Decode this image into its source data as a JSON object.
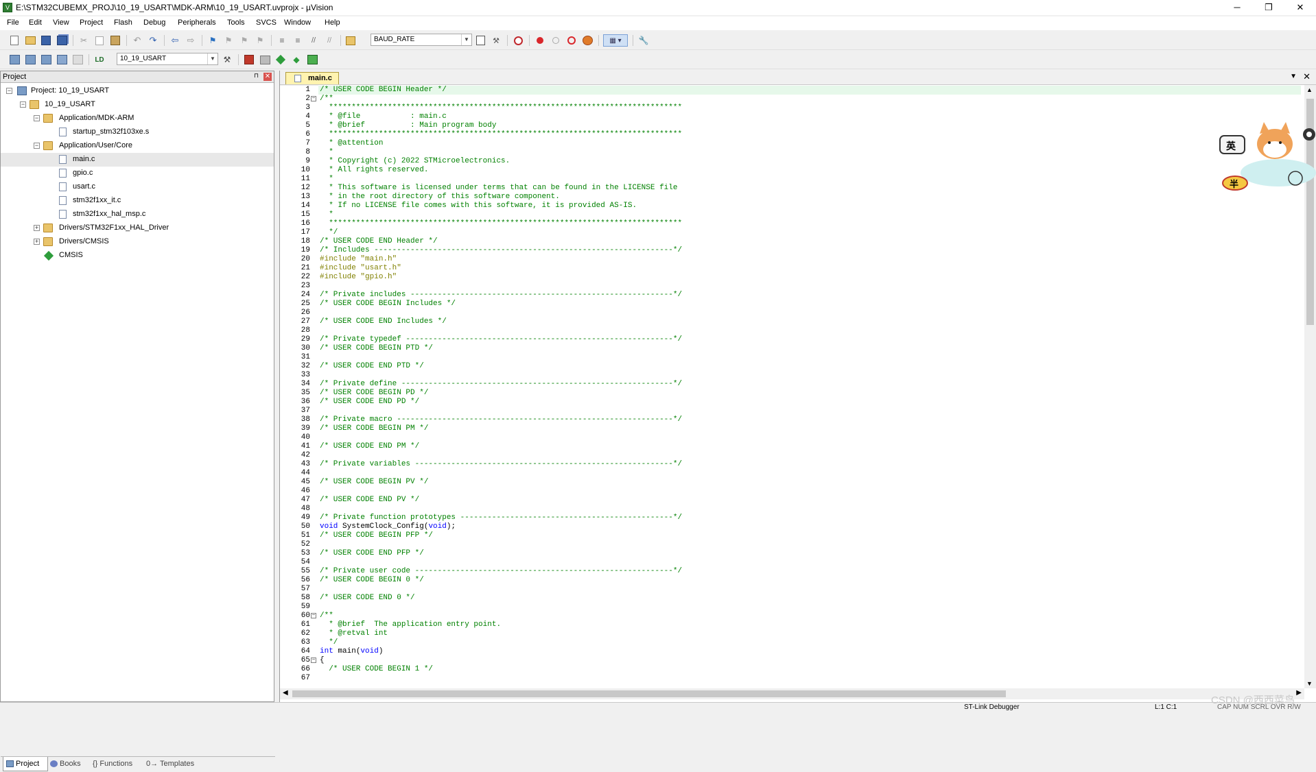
{
  "window": {
    "title": "E:\\STM32CUBEMX_PROJ\\10_19_USART\\MDK-ARM\\10_19_USART.uvprojx - µVision",
    "minimize": "─",
    "restore": "❐",
    "close": "✕"
  },
  "menu": [
    "File",
    "Edit",
    "View",
    "Project",
    "Flash",
    "Debug",
    "Peripherals",
    "Tools",
    "SVCS",
    "Window",
    "Help"
  ],
  "toolbar": {
    "find_combo_value": "BAUD_RATE",
    "target_combo_value": "10_19_USART"
  },
  "project_panel": {
    "title": "Project",
    "pin": "⊓",
    "close": "✕",
    "tree": [
      {
        "label": "Project: 10_19_USART",
        "toggle": "−"
      },
      {
        "label": "10_19_USART",
        "toggle": "−"
      },
      {
        "label": "Application/MDK-ARM",
        "toggle": "−"
      },
      {
        "label": "startup_stm32f103xe.s",
        "toggle": ""
      },
      {
        "label": "Application/User/Core",
        "toggle": "−"
      },
      {
        "label": "main.c",
        "toggle": ""
      },
      {
        "label": "gpio.c",
        "toggle": ""
      },
      {
        "label": "usart.c",
        "toggle": ""
      },
      {
        "label": "stm32f1xx_it.c",
        "toggle": ""
      },
      {
        "label": "stm32f1xx_hal_msp.c",
        "toggle": ""
      },
      {
        "label": "Drivers/STM32F1xx_HAL_Driver",
        "toggle": "+"
      },
      {
        "label": "Drivers/CMSIS",
        "toggle": "+"
      },
      {
        "label": "CMSIS",
        "toggle": ""
      }
    ],
    "tabs": [
      "Project",
      "Books",
      "{} Functions",
      "0→ Templates"
    ]
  },
  "editor": {
    "tab": "main.c",
    "tab_dropdown": "▼",
    "tab_close": "✕",
    "lines": [
      {
        "n": "1",
        "t": "/* USER CODE BEGIN Header */",
        "c": "comment"
      },
      {
        "n": "2",
        "t": "/**",
        "c": "comment",
        "f": "−"
      },
      {
        "n": "3",
        "t": "  ******************************************************************************",
        "c": "comment"
      },
      {
        "n": "4",
        "t": "  * @file           : main.c",
        "c": "comment"
      },
      {
        "n": "5",
        "t": "  * @brief          : Main program body",
        "c": "comment"
      },
      {
        "n": "6",
        "t": "  ******************************************************************************",
        "c": "comment"
      },
      {
        "n": "7",
        "t": "  * @attention",
        "c": "comment"
      },
      {
        "n": "8",
        "t": "  *",
        "c": "comment"
      },
      {
        "n": "9",
        "t": "  * Copyright (c) 2022 STMicroelectronics.",
        "c": "comment"
      },
      {
        "n": "10",
        "t": "  * All rights reserved.",
        "c": "comment"
      },
      {
        "n": "11",
        "t": "  *",
        "c": "comment"
      },
      {
        "n": "12",
        "t": "  * This software is licensed under terms that can be found in the LICENSE file",
        "c": "comment"
      },
      {
        "n": "13",
        "t": "  * in the root directory of this software component.",
        "c": "comment"
      },
      {
        "n": "14",
        "t": "  * If no LICENSE file comes with this software, it is provided AS-IS.",
        "c": "comment"
      },
      {
        "n": "15",
        "t": "  *",
        "c": "comment"
      },
      {
        "n": "16",
        "t": "  ******************************************************************************",
        "c": "comment"
      },
      {
        "n": "17",
        "t": "  */",
        "c": "comment"
      },
      {
        "n": "18",
        "t": "/* USER CODE END Header */",
        "c": "comment"
      },
      {
        "n": "19",
        "t": "/* Includes ------------------------------------------------------------------*/",
        "c": "comment"
      },
      {
        "n": "20",
        "t": "#include \"main.h\"",
        "c": "pre"
      },
      {
        "n": "21",
        "t": "#include \"usart.h\"",
        "c": "pre"
      },
      {
        "n": "22",
        "t": "#include \"gpio.h\"",
        "c": "pre"
      },
      {
        "n": "23",
        "t": "",
        "c": "code"
      },
      {
        "n": "24",
        "t": "/* Private includes ----------------------------------------------------------*/",
        "c": "comment"
      },
      {
        "n": "25",
        "t": "/* USER CODE BEGIN Includes */",
        "c": "comment"
      },
      {
        "n": "26",
        "t": "",
        "c": "code"
      },
      {
        "n": "27",
        "t": "/* USER CODE END Includes */",
        "c": "comment"
      },
      {
        "n": "28",
        "t": "",
        "c": "code"
      },
      {
        "n": "29",
        "t": "/* Private typedef -----------------------------------------------------------*/",
        "c": "comment"
      },
      {
        "n": "30",
        "t": "/* USER CODE BEGIN PTD */",
        "c": "comment"
      },
      {
        "n": "31",
        "t": "",
        "c": "code"
      },
      {
        "n": "32",
        "t": "/* USER CODE END PTD */",
        "c": "comment"
      },
      {
        "n": "33",
        "t": "",
        "c": "code"
      },
      {
        "n": "34",
        "t": "/* Private define ------------------------------------------------------------*/",
        "c": "comment"
      },
      {
        "n": "35",
        "t": "/* USER CODE BEGIN PD */",
        "c": "comment"
      },
      {
        "n": "36",
        "t": "/* USER CODE END PD */",
        "c": "comment"
      },
      {
        "n": "37",
        "t": "",
        "c": "code"
      },
      {
        "n": "38",
        "t": "/* Private macro -------------------------------------------------------------*/",
        "c": "comment"
      },
      {
        "n": "39",
        "t": "/* USER CODE BEGIN PM */",
        "c": "comment"
      },
      {
        "n": "40",
        "t": "",
        "c": "code"
      },
      {
        "n": "41",
        "t": "/* USER CODE END PM */",
        "c": "comment"
      },
      {
        "n": "42",
        "t": "",
        "c": "code"
      },
      {
        "n": "43",
        "t": "/* Private variables ---------------------------------------------------------*/",
        "c": "comment"
      },
      {
        "n": "44",
        "t": "",
        "c": "code"
      },
      {
        "n": "45",
        "t": "/* USER CODE BEGIN PV */",
        "c": "comment"
      },
      {
        "n": "46",
        "t": "",
        "c": "code"
      },
      {
        "n": "47",
        "t": "/* USER CODE END PV */",
        "c": "comment"
      },
      {
        "n": "48",
        "t": "",
        "c": "code"
      },
      {
        "n": "49",
        "t": "/* Private function prototypes -----------------------------------------------*/",
        "c": "comment"
      },
      {
        "n": "50",
        "t": "void SystemClock_Config(void);",
        "c": "code"
      },
      {
        "n": "51",
        "t": "/* USER CODE BEGIN PFP */",
        "c": "comment"
      },
      {
        "n": "52",
        "t": "",
        "c": "code"
      },
      {
        "n": "53",
        "t": "/* USER CODE END PFP */",
        "c": "comment"
      },
      {
        "n": "54",
        "t": "",
        "c": "code"
      },
      {
        "n": "55",
        "t": "/* Private user code ---------------------------------------------------------*/",
        "c": "comment"
      },
      {
        "n": "56",
        "t": "/* USER CODE BEGIN 0 */",
        "c": "comment"
      },
      {
        "n": "57",
        "t": "",
        "c": "code"
      },
      {
        "n": "58",
        "t": "/* USER CODE END 0 */",
        "c": "comment"
      },
      {
        "n": "59",
        "t": "",
        "c": "code"
      },
      {
        "n": "60",
        "t": "/**",
        "c": "comment",
        "f": "−"
      },
      {
        "n": "61",
        "t": "  * @brief  The application entry point.",
        "c": "comment"
      },
      {
        "n": "62",
        "t": "  * @retval int",
        "c": "comment"
      },
      {
        "n": "63",
        "t": "  */",
        "c": "comment"
      },
      {
        "n": "64",
        "t": "int main(void)",
        "c": "code"
      },
      {
        "n": "65",
        "t": "{",
        "c": "code",
        "f": "−"
      },
      {
        "n": "66",
        "t": "  /* USER CODE BEGIN 1 */",
        "c": "comment"
      },
      {
        "n": "67",
        "t": "",
        "c": "code"
      }
    ]
  },
  "status": {
    "debugger": "ST-Link Debugger",
    "position": "L:1 C:1",
    "indicators": "CAP  NUM  SCRL  OVR  R/W"
  },
  "overlay": {
    "watermark": "CSDN @西西菜鸟",
    "ime_label_1": "英",
    "ime_label_2": "半"
  },
  "colors": {
    "comment": "#008000",
    "preprocessor": "#808000",
    "keyword": "#0000ff",
    "active_tab": "#fff3b0",
    "current_line": "#e6f8ea"
  }
}
